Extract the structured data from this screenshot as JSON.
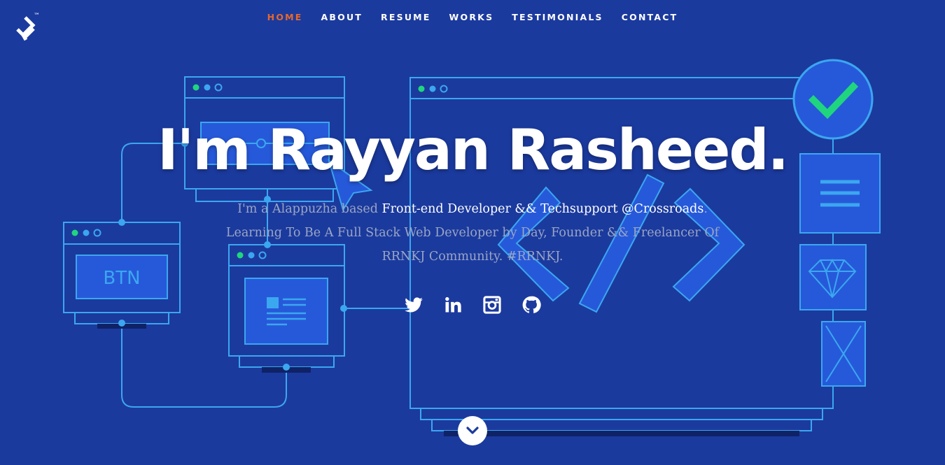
{
  "nav": {
    "logo_tm": "™",
    "items": [
      {
        "label": "HOME",
        "active": true
      },
      {
        "label": "ABOUT",
        "active": false
      },
      {
        "label": "RESUME",
        "active": false
      },
      {
        "label": "WORKS",
        "active": false
      },
      {
        "label": "TESTIMONIALS",
        "active": false
      },
      {
        "label": "CONTACT",
        "active": false
      }
    ]
  },
  "hero": {
    "title": "I'm Rayyan Rasheed.",
    "tag_1": "I'm a Alappuzha based ",
    "tag_2": "Front-end Developer && Techsupport @Crossroads",
    "tag_3": ". Learning To Be A Full Stack Web Developer by Day, Founder && Freelancer Of RRNKJ Community. #RRNKJ."
  },
  "illustration": {
    "btn_label": "BTN"
  },
  "social": [
    "twitter-icon",
    "linkedin-icon",
    "instagram-icon",
    "github-icon"
  ],
  "colors": {
    "background": "#1b3a9e",
    "accent": "#e8682a",
    "line": "#3ba7f0",
    "check": "#1fd67f"
  }
}
